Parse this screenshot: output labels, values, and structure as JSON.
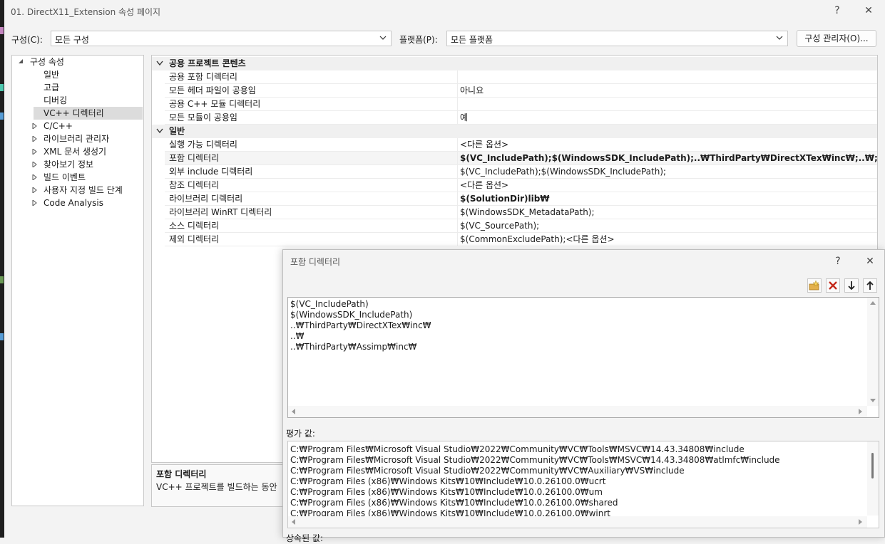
{
  "window": {
    "title": "01. DirectX11_Extension 속성 페이지",
    "help_glyph": "?",
    "close_glyph": "✕"
  },
  "config_bar": {
    "config_label": "구성(C):",
    "config_value": "모든 구성",
    "platform_label": "플랫폼(P):",
    "platform_value": "모든 플랫폼",
    "manager_button": "구성 관리자(O)..."
  },
  "tree": {
    "root": "구성 속성",
    "items": [
      {
        "label": "일반"
      },
      {
        "label": "고급"
      },
      {
        "label": "디버깅"
      },
      {
        "label": "VC++ 디렉터리",
        "selected": true
      },
      {
        "label": "C/C++"
      },
      {
        "label": "라이브러리 관리자"
      },
      {
        "label": "XML 문서 생성기"
      },
      {
        "label": "찾아보기 정보"
      },
      {
        "label": "빌드 이벤트"
      },
      {
        "label": "사용자 지정 빌드 단계"
      },
      {
        "label": "Code Analysis"
      }
    ]
  },
  "grid": {
    "categories": [
      {
        "name": "공용 프로젝트 콘텐츠",
        "rows": [
          {
            "name": "공용 포함 디렉터리",
            "value": ""
          },
          {
            "name": "모든 헤더 파일이 공용임",
            "value": "아니요"
          },
          {
            "name": "공용 C++ 모듈 디렉터리",
            "value": ""
          },
          {
            "name": "모든 모듈이 공용임",
            "value": "예"
          }
        ]
      },
      {
        "name": "일반",
        "rows": [
          {
            "name": "실행 가능 디렉터리",
            "value": "<다른 옵션>"
          },
          {
            "name": "포함 디렉터리",
            "value": "$(VC_IncludePath);$(WindowsSDK_IncludePath);..₩ThirdParty₩DirectXTex₩inc₩;..₩;..₩ThirdParty₩Assimp₩inc₩"
          },
          {
            "name": "외부 include 디렉터리",
            "value": "$(VC_IncludePath);$(WindowsSDK_IncludePath);"
          },
          {
            "name": "참조 디렉터리",
            "value": "<다른 옵션>"
          },
          {
            "name": "라이브러리 디렉터리",
            "value": "$(SolutionDir)lib₩"
          },
          {
            "name": "라이브러리 WinRT 디렉터리",
            "value": "$(WindowsSDK_MetadataPath);"
          },
          {
            "name": "소스 디렉터리",
            "value": "$(VC_SourcePath);"
          },
          {
            "name": "제외 디렉터리",
            "value": "$(CommonExcludePath);<다른 옵션>"
          }
        ]
      }
    ]
  },
  "description": {
    "title": "포함 디렉터리",
    "text": "VC++ 프로젝트를 빌드하는 동안"
  },
  "dialog": {
    "title": "포함 디렉터리",
    "help_glyph": "?",
    "close_glyph": "✕",
    "entries": [
      "$(VC_IncludePath)",
      "$(WindowsSDK_IncludePath)",
      "..₩ThirdParty₩DirectXTex₩inc₩",
      "..₩",
      "..₩ThirdParty₩Assimp₩inc₩"
    ],
    "eval_label": "평가 값:",
    "evaluated": [
      "C:₩Program Files₩Microsoft Visual Studio₩2022₩Community₩VC₩Tools₩MSVC₩14.43.34808₩include",
      "C:₩Program Files₩Microsoft Visual Studio₩2022₩Community₩VC₩Tools₩MSVC₩14.43.34808₩atlmfc₩include",
      "C:₩Program Files₩Microsoft Visual Studio₩2022₩Community₩VC₩Auxiliary₩VS₩include",
      "C:₩Program Files (x86)₩Windows Kits₩10₩Include₩10.0.26100.0₩ucrt",
      "C:₩Program Files (x86)₩Windows Kits₩10₩Include₩10.0.26100.0₩um",
      "C:₩Program Files (x86)₩Windows Kits₩10₩Include₩10.0.26100.0₩shared",
      "C:₩Program Files (x86)₩Windows Kits₩10₩Include₩10.0.26100.0₩winrt"
    ],
    "inherited_label": "상속된 값:"
  },
  "colors": {
    "new_line_icon": "#e3b04b",
    "delete_icon": "#c42b1c"
  }
}
